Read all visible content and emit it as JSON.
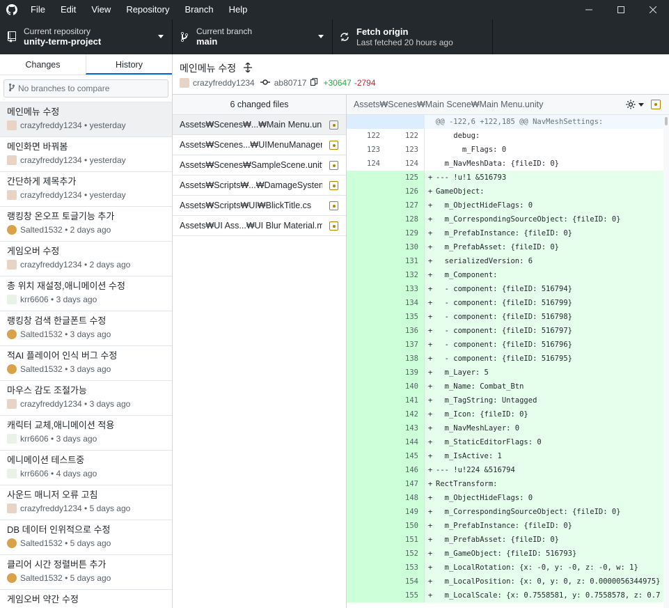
{
  "menu": [
    "File",
    "Edit",
    "View",
    "Repository",
    "Branch",
    "Help"
  ],
  "toolbar": {
    "repo_label": "Current repository",
    "repo_name": "unity-term-project",
    "branch_label": "Current branch",
    "branch_name": "main",
    "fetch_label": "Fetch origin",
    "fetch_sub": "Last fetched 20 hours ago"
  },
  "tabs": {
    "changes": "Changes",
    "history": "History"
  },
  "branch_compare_placeholder": "No branches to compare",
  "commits": [
    {
      "message": "메인메뉴 수정",
      "author": "crazyfreddy1234",
      "when": "yesterday",
      "avatar": "crazy"
    },
    {
      "message": "메인화면 바꿔봄",
      "author": "crazyfreddy1234",
      "when": "yesterday",
      "avatar": "crazy"
    },
    {
      "message": "간단하게 제목추가",
      "author": "crazyfreddy1234",
      "when": "yesterday",
      "avatar": "crazy"
    },
    {
      "message": "랭킹창 온오프 토글기능 추가",
      "author": "Salted1532",
      "when": "2 days ago",
      "avatar": "salted"
    },
    {
      "message": "게임오버 수정",
      "author": "crazyfreddy1234",
      "when": "2 days ago",
      "avatar": "crazy"
    },
    {
      "message": "총 위치 재설정,애니메이션 수정",
      "author": "krr6606",
      "when": "3 days ago",
      "avatar": "krr"
    },
    {
      "message": "랭킹창 검색 한글폰트 수정",
      "author": "Salted1532",
      "when": "3 days ago",
      "avatar": "salted"
    },
    {
      "message": "적AI 플레이어 인식 버그 수정",
      "author": "Salted1532",
      "when": "3 days ago",
      "avatar": "salted"
    },
    {
      "message": "마우스 감도 조절가능",
      "author": "crazyfreddy1234",
      "when": "3 days ago",
      "avatar": "crazy"
    },
    {
      "message": "캐릭터 교체,애니메이션 적용",
      "author": "krr6606",
      "when": "3 days ago",
      "avatar": "krr"
    },
    {
      "message": "에니메이션 테스트중",
      "author": "krr6606",
      "when": "4 days ago",
      "avatar": "krr"
    },
    {
      "message": "사운드 매니저 오류 고침",
      "author": "crazyfreddy1234",
      "when": "5 days ago",
      "avatar": "crazy"
    },
    {
      "message": "DB 데이터 인위적으로 수정",
      "author": "Salted1532",
      "when": "5 days ago",
      "avatar": "salted"
    },
    {
      "message": "클리어 시간 정렬버튼 추가",
      "author": "Salted1532",
      "when": "5 days ago",
      "avatar": "salted"
    },
    {
      "message": "게임오버 약간 수정",
      "author": "",
      "when": "",
      "avatar": ""
    }
  ],
  "selected_commit": {
    "title": "메인메뉴 수정",
    "author": "crazyfreddy1234",
    "sha": "ab80717",
    "additions": "+30647",
    "deletions": "-2794"
  },
  "files_header": "6 changed files",
  "files": [
    "Assets₩Scenes₩...₩Main Menu.unity",
    "Assets₩Scenes...₩UIMenuManager.cs",
    "Assets₩Scenes₩SampleScene.unity",
    "Assets₩Scripts₩...₩DamageSystem.cs",
    "Assets₩Scripts₩UI₩BlickTitle.cs",
    "Assets₩UI Ass...₩UI Blur Material.mat"
  ],
  "diff": {
    "path": "Assets₩Scenes₩Main Scene₩Main Menu.unity",
    "lines": [
      {
        "type": "hunk",
        "old": "",
        "new": "",
        "sign": "",
        "text": "@@ -122,6 +122,185 @@ NavMeshSettings:"
      },
      {
        "type": "ctx",
        "old": "122",
        "new": "122",
        "sign": "",
        "text": "    debug:"
      },
      {
        "type": "ctx",
        "old": "123",
        "new": "123",
        "sign": "",
        "text": "      m_Flags: 0"
      },
      {
        "type": "ctx",
        "old": "124",
        "new": "124",
        "sign": "",
        "text": "  m_NavMeshData: {fileID: 0}"
      },
      {
        "type": "add",
        "old": "",
        "new": "125",
        "sign": "+",
        "text": "--- !u!1 &516793"
      },
      {
        "type": "add",
        "old": "",
        "new": "126",
        "sign": "+",
        "text": "GameObject:"
      },
      {
        "type": "add",
        "old": "",
        "new": "127",
        "sign": "+",
        "text": "  m_ObjectHideFlags: 0"
      },
      {
        "type": "add",
        "old": "",
        "new": "128",
        "sign": "+",
        "text": "  m_CorrespondingSourceObject: {fileID: 0}"
      },
      {
        "type": "add",
        "old": "",
        "new": "129",
        "sign": "+",
        "text": "  m_PrefabInstance: {fileID: 0}"
      },
      {
        "type": "add",
        "old": "",
        "new": "130",
        "sign": "+",
        "text": "  m_PrefabAsset: {fileID: 0}"
      },
      {
        "type": "add",
        "old": "",
        "new": "131",
        "sign": "+",
        "text": "  serializedVersion: 6"
      },
      {
        "type": "add",
        "old": "",
        "new": "132",
        "sign": "+",
        "text": "  m_Component:"
      },
      {
        "type": "add",
        "old": "",
        "new": "133",
        "sign": "+",
        "text": "  - component: {fileID: 516794}"
      },
      {
        "type": "add",
        "old": "",
        "new": "134",
        "sign": "+",
        "text": "  - component: {fileID: 516799}"
      },
      {
        "type": "add",
        "old": "",
        "new": "135",
        "sign": "+",
        "text": "  - component: {fileID: 516798}"
      },
      {
        "type": "add",
        "old": "",
        "new": "136",
        "sign": "+",
        "text": "  - component: {fileID: 516797}"
      },
      {
        "type": "add",
        "old": "",
        "new": "137",
        "sign": "+",
        "text": "  - component: {fileID: 516796}"
      },
      {
        "type": "add",
        "old": "",
        "new": "138",
        "sign": "+",
        "text": "  - component: {fileID: 516795}"
      },
      {
        "type": "add",
        "old": "",
        "new": "139",
        "sign": "+",
        "text": "  m_Layer: 5"
      },
      {
        "type": "add",
        "old": "",
        "new": "140",
        "sign": "+",
        "text": "  m_Name: Combat_Btn"
      },
      {
        "type": "add",
        "old": "",
        "new": "141",
        "sign": "+",
        "text": "  m_TagString: Untagged"
      },
      {
        "type": "add",
        "old": "",
        "new": "142",
        "sign": "+",
        "text": "  m_Icon: {fileID: 0}"
      },
      {
        "type": "add",
        "old": "",
        "new": "143",
        "sign": "+",
        "text": "  m_NavMeshLayer: 0"
      },
      {
        "type": "add",
        "old": "",
        "new": "144",
        "sign": "+",
        "text": "  m_StaticEditorFlags: 0"
      },
      {
        "type": "add",
        "old": "",
        "new": "145",
        "sign": "+",
        "text": "  m_IsActive: 1"
      },
      {
        "type": "add",
        "old": "",
        "new": "146",
        "sign": "+",
        "text": "--- !u!224 &516794"
      },
      {
        "type": "add",
        "old": "",
        "new": "147",
        "sign": "+",
        "text": "RectTransform:"
      },
      {
        "type": "add",
        "old": "",
        "new": "148",
        "sign": "+",
        "text": "  m_ObjectHideFlags: 0"
      },
      {
        "type": "add",
        "old": "",
        "new": "149",
        "sign": "+",
        "text": "  m_CorrespondingSourceObject: {fileID: 0}"
      },
      {
        "type": "add",
        "old": "",
        "new": "150",
        "sign": "+",
        "text": "  m_PrefabInstance: {fileID: 0}"
      },
      {
        "type": "add",
        "old": "",
        "new": "151",
        "sign": "+",
        "text": "  m_PrefabAsset: {fileID: 0}"
      },
      {
        "type": "add",
        "old": "",
        "new": "152",
        "sign": "+",
        "text": "  m_GameObject: {fileID: 516793}"
      },
      {
        "type": "add",
        "old": "",
        "new": "153",
        "sign": "+",
        "text": "  m_LocalRotation: {x: -0, y: -0, z: -0, w: 1}"
      },
      {
        "type": "add",
        "old": "",
        "new": "154",
        "sign": "+",
        "text": "  m_LocalPosition: {x: 0, y: 0, z: 0.0000056344975}"
      },
      {
        "type": "add",
        "old": "",
        "new": "155",
        "sign": "+",
        "text": "  m_LocalScale: {x: 0.7558581, y: 0.7558578, z: 0.7"
      }
    ]
  },
  "colors": {
    "titlebar_bg": "#24292e",
    "added_bg": "#e6ffed",
    "hunk_bg": "#f1f8ff",
    "modified_badge": "#b08800",
    "additions": "#28a745",
    "deletions": "#cb2431"
  },
  "icons": {
    "logo": "github-icon",
    "repo": "repo-icon",
    "branch": "branch-icon",
    "fetch": "sync-icon",
    "settings": "gear-icon"
  }
}
